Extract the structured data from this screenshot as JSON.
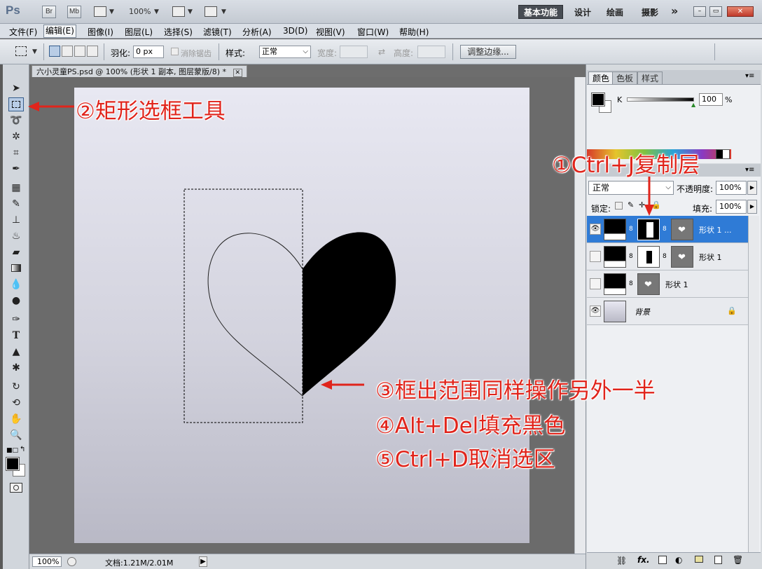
{
  "app": {
    "logo": "Ps",
    "bridge_label": "Br",
    "minibridge_label": "Mb",
    "zoom": "100%",
    "workspaces": [
      "基本功能",
      "设计",
      "绘画",
      "摄影"
    ],
    "more": "»",
    "window_controls": {
      "minimize": "–",
      "restore": "▭",
      "close": "✕"
    }
  },
  "menu": [
    "文件(F)",
    "编辑(E)",
    "图像(I)",
    "图层(L)",
    "选择(S)",
    "滤镜(T)",
    "分析(A)",
    "3D(D)",
    "视图(V)",
    "窗口(W)",
    "帮助(H)"
  ],
  "options": {
    "feather_label": "羽化:",
    "feather_value": "0 px",
    "antialias_label": "消除锯齿",
    "style_label": "样式:",
    "style_value": "正常",
    "width_label": "宽度:",
    "height_label": "高度:",
    "refine_edge": "调整边缘..."
  },
  "document": {
    "tab_title": "六小灵童PS.psd @ 100% (形状 1 副本, 图层蒙版/8) *",
    "tab_close": "✕"
  },
  "status": {
    "zoom": "100%",
    "doc_info": "文档:1.21M/2.01M"
  },
  "color_panel": {
    "tabs": [
      "颜色",
      "色板",
      "样式"
    ],
    "channel_label": "K",
    "channel_value": "100",
    "unit": "%"
  },
  "layers_panel": {
    "blend_mode": "正常",
    "opacity_label": "不透明度:",
    "opacity_value": "100%",
    "lock_label": "锁定:",
    "fill_label": "填充:",
    "fill_value": "100%",
    "layers": [
      {
        "name": "形状 1 ...",
        "selected": true,
        "visible": true
      },
      {
        "name": "形状 1",
        "selected": false,
        "visible": false
      },
      {
        "name": "形状 1",
        "selected": false,
        "visible": false
      },
      {
        "name": "背景",
        "selected": false,
        "visible": true,
        "locked": true
      }
    ],
    "footer_icons": [
      "link-icon",
      "fx-icon",
      "mask-icon",
      "adjustment-icon",
      "group-icon",
      "new-layer-icon",
      "trash-icon"
    ]
  },
  "annotations": {
    "step1": "①Ctrl+J复制层",
    "step2": "②矩形选框工具",
    "step3": "③框出范围同样操作另外一半",
    "step4": "④Alt+Del填充黑色",
    "step5": "⑤Ctrl+D取消选区"
  },
  "colors": {
    "annotation_red": "#e0241b",
    "selected_layer": "#2f7bd6",
    "workspace_active": "#474c53"
  }
}
